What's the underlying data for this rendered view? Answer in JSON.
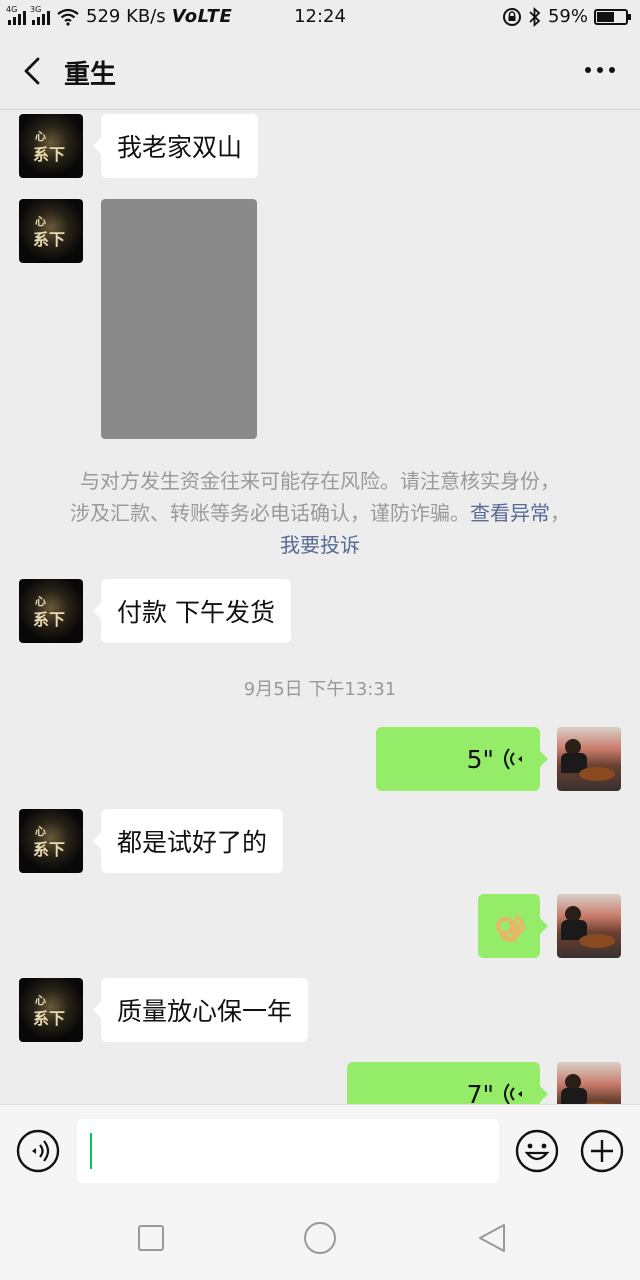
{
  "status_bar": {
    "net_4g": "4G",
    "net_3g": "3G",
    "speed": "529 KB/s",
    "volte": "VoLTE",
    "time": "12:24",
    "battery": "59%",
    "battery_level": 0.59
  },
  "header": {
    "title": "重生"
  },
  "messages": {
    "m1": "我老家双山",
    "m3": "付款 下午发货",
    "voice1": "5\"",
    "m5": "都是试好了的",
    "m7": "质量放心保一年",
    "voice2": "7\""
  },
  "risk_notice": {
    "line1": "与对方发生资金往来可能存在风险。请注意核实身份，",
    "line2_text": "涉及汇款、转账等务必电话确认，谨防诈骗。",
    "check_link": "查看异常",
    "comma": "，",
    "complain_link": "我要投诉"
  },
  "timestamp": "9月5日 下午13:31",
  "avatar_glyph": "心系下",
  "colors": {
    "background": "#ededed",
    "bubble_self": "#95ec69",
    "bubble_other": "#ffffff",
    "link": "#576b95",
    "caret": "#07c160"
  }
}
